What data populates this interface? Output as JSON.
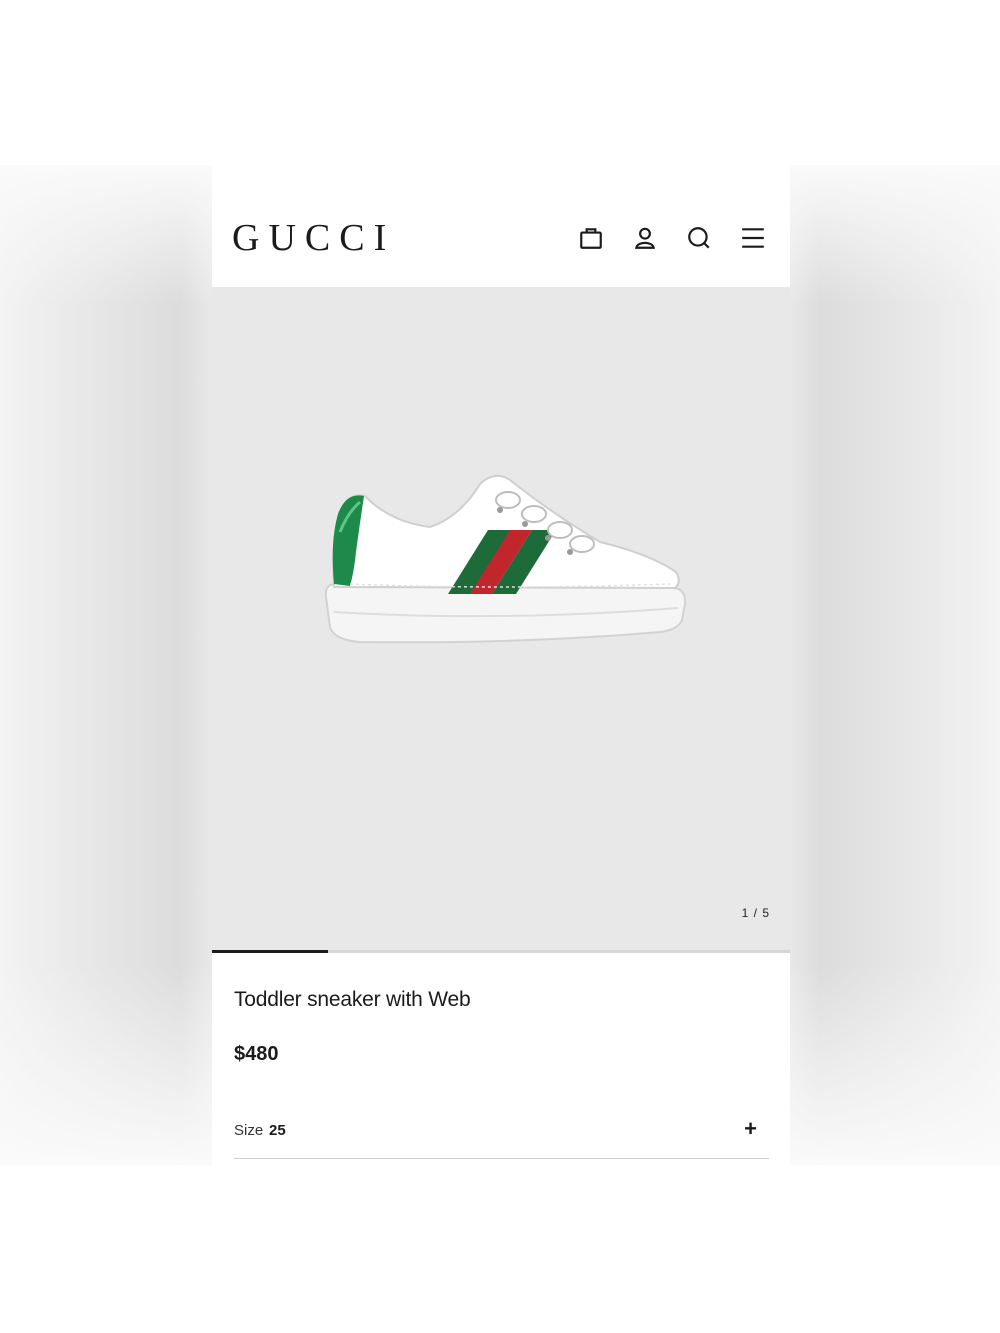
{
  "header": {
    "brand": "GUCCI",
    "icons": [
      "shopping-bag-icon",
      "account-icon",
      "search-icon",
      "menu-icon"
    ]
  },
  "gallery": {
    "image_alt": "Toddler sneaker with Web",
    "current_index": 1,
    "total": 5,
    "counter_text": "1 / 5",
    "progress_fraction": 0.2
  },
  "product": {
    "title": "Toddler sneaker with Web",
    "price": "$480",
    "size_label": "Size",
    "size_value": "25",
    "expand_symbol": "+"
  },
  "colors": {
    "web_green": "#1e6b3a",
    "web_red": "#c0262b",
    "gallery_bg": "#e8e8e8",
    "text": "#1b1b1b"
  }
}
